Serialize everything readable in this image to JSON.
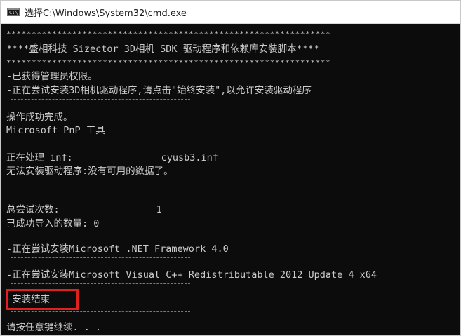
{
  "window": {
    "title": "选择C:\\Windows\\System32\\cmd.exe",
    "icon": "cmd-icon"
  },
  "console": {
    "stars_1": "****************************************************************",
    "banner": "****盛相科技 Sizector 3D相机 SDK 驱动程序和依赖库安装脚本****",
    "stars_2": "****************************************************************",
    "admin": "-已获得管理员权限。",
    "install_driver": "-正在尝试安装3D相机驱动程序,请点击\"始终安装\",以允许安装驱动程序",
    "op_success": "操作成功完成。",
    "pnp_tool": "Microsoft PnP 工具",
    "processing_label": "正在处理 inf:",
    "processing_value": "cyusb3.inf",
    "cannot_install": "无法安装驱动程序:没有可用的数据了。",
    "total_attempts_label": "总尝试次数:",
    "total_attempts_value": "1",
    "imported_count": "已成功导入的数量: 0",
    "dotnet": "-正在尝试安装Microsoft .NET Framework 4.0",
    "vcpp": "-正在尝试安装Microsoft Visual C++ Redistributable 2012 Update 4 x64",
    "install_done": "-安装结束",
    "press_any_key": "请按任意键继续. . ."
  },
  "colors": {
    "console_bg": "#0c0c0c",
    "console_text": "#cccccc",
    "highlight": "#e0201c"
  }
}
